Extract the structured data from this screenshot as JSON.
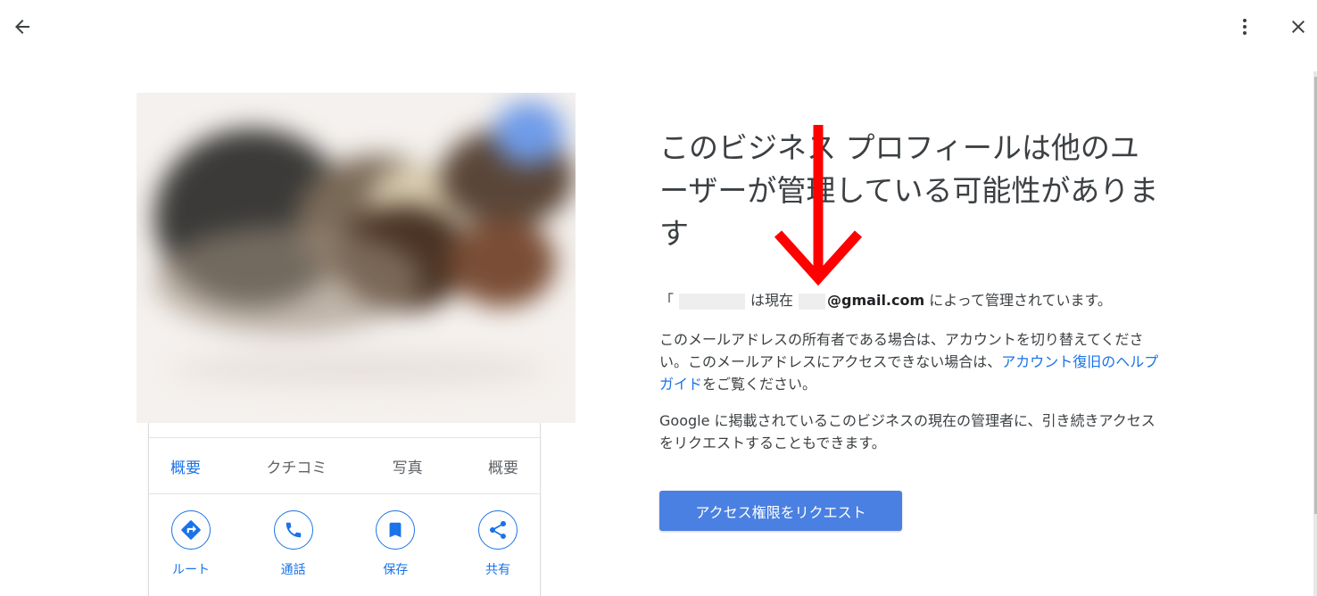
{
  "topbar": {
    "back_icon": "arrow-left-icon",
    "more_icon": "more-vert-icon",
    "close_icon": "close-icon"
  },
  "preview": {
    "tabs": [
      {
        "label": "概要",
        "active": true
      },
      {
        "label": "クチコミ",
        "active": false
      },
      {
        "label": "写真",
        "active": false
      },
      {
        "label": "概要",
        "active": false
      }
    ],
    "actions": [
      {
        "label": "ルート",
        "icon": "directions-icon"
      },
      {
        "label": "通話",
        "icon": "phone-icon"
      },
      {
        "label": "保存",
        "icon": "bookmark-icon"
      },
      {
        "label": "共有",
        "icon": "share-icon"
      }
    ]
  },
  "main": {
    "title": "このビジネス プロフィールは他のユーザーが管理している可能性があります",
    "owner_open_bracket": "「",
    "owner_mid": "は現在",
    "owner_email": "@gmail.com",
    "owner_suffix": "によって管理されています。",
    "para1_text": "このメールアドレスの所有者である場合は、アカウントを切り替えてください。このメールアドレスにアクセスできない場合は、",
    "para1_link": "アカウント復旧のヘルプガイド",
    "para1_suffix": "をご覧ください。",
    "para2": "Google に掲載されているこのビジネスの現在の管理者に、引き続きアクセスをリクエストすることもできます。",
    "request_button": "アクセス権限をリクエスト"
  },
  "colors": {
    "accent": "#1a73e8",
    "button": "#4a80e2",
    "annotation": "#ff0000"
  }
}
